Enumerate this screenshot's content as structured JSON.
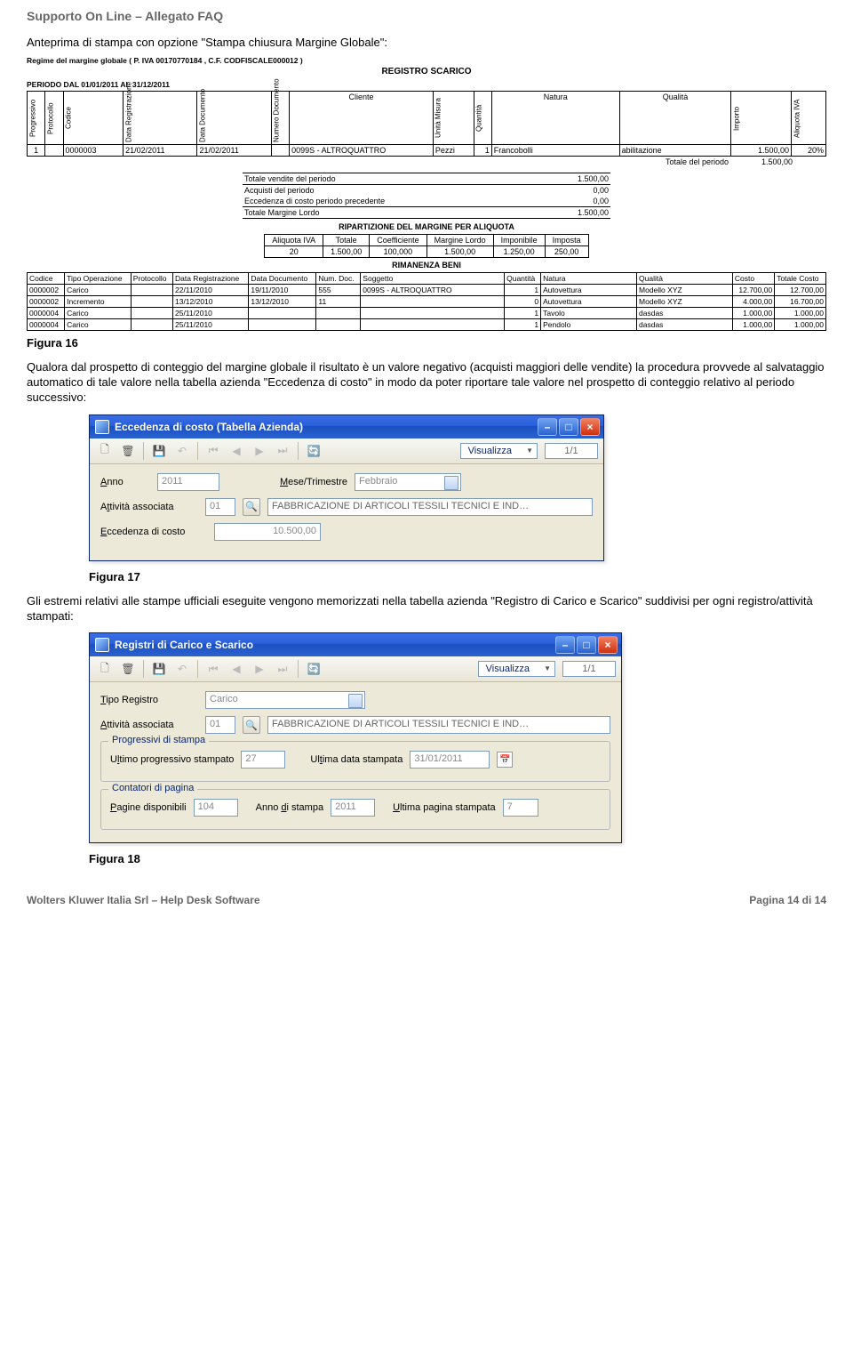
{
  "page": {
    "header": "Supporto On Line – Allegato FAQ",
    "intro": "Anteprima di stampa con opzione \"Stampa chiusura Margine Globale\":",
    "fig16": "Figura 16",
    "para1": "Qualora dal prospetto di conteggio del margine globale il risultato è un valore negativo (acquisti maggiori delle vendite) la procedura provvede al salvataggio automatico di tale valore nella tabella azienda \"Eccedenza di costo\" in modo da poter riportare tale valore nel prospetto di conteggio relativo al periodo successivo:",
    "fig17": "Figura 17",
    "para2": "Gli estremi relativi alle stampe ufficiali eseguite vengono memorizzati nella tabella azienda \"Registro di Carico e Scarico\" suddivisi per ogni registro/attività stampati:",
    "fig18": "Figura 18",
    "footer_left": "Wolters Kluwer Italia Srl – Help Desk Software",
    "footer_right": "Pagina 14 di 14"
  },
  "report": {
    "regime": "Regime del margine globale ( P. IVA 00170770184 , C.F. CODFISCALE000012 )",
    "title": "REGISTRO SCARICO",
    "period": "PERIODO DAL 01/01/2011 AL 31/12/2011",
    "cols": [
      "Progressivo",
      "Protocollo",
      "Codice",
      "Data Registrazione",
      "Data Documento",
      "Numero Documento",
      "Cliente",
      "Unità Misura",
      "Quantità",
      "Natura",
      "Qualità",
      "Importo",
      "Aliquota IVA"
    ],
    "row": [
      "1",
      "",
      "0000003",
      "21/02/2011",
      "21/02/2011",
      "",
      "0099S - ALTROQUATTRO",
      "Pezzi",
      "1",
      "Francobolli",
      "abilitazione",
      "1.500,00",
      "20%"
    ],
    "totperiodo_lbl": "Totale del periodo",
    "totperiodo_val": "1.500,00",
    "summaries": [
      {
        "l": "Totale vendite del periodo",
        "v": "1.500,00"
      },
      {
        "l": "Acquisti del periodo",
        "v": "0,00"
      },
      {
        "l": "Eccedenza di costo periodo precedente",
        "v": "0,00"
      },
      {
        "l": "Totale Margine Lordo",
        "v": "1.500,00"
      }
    ],
    "sub1": "RIPARTIZIONE DEL MARGINE PER ALIQUOTA",
    "aliquota_cols": [
      "Aliquota IVA",
      "Totale",
      "Coefficiente",
      "Margine Lordo",
      "Imponibile",
      "Imposta"
    ],
    "aliquota_row": [
      "20",
      "1.500,00",
      "100,000",
      "1.500,00",
      "1.250,00",
      "250,00"
    ],
    "sub2": "RIMANENZA BENI",
    "rim_cols": [
      "Codice",
      "Tipo Operazione",
      "Protocollo",
      "Data Registrazione",
      "Data Documento",
      "Num. Doc.",
      "Soggetto",
      "Quantità",
      "Natura",
      "Qualità",
      "Costo",
      "Totale Costo"
    ],
    "rim_rows": [
      [
        "0000002",
        "Carico",
        "",
        "22/11/2010",
        "19/11/2010",
        "555",
        "0099S - ALTROQUATTRO",
        "1",
        "Autovettura",
        "Modello XYZ",
        "12.700,00",
        "12.700,00"
      ],
      [
        "0000002",
        "Incremento",
        "",
        "13/12/2010",
        "13/12/2010",
        "11",
        "",
        "0",
        "Autovettura",
        "Modello XYZ",
        "4.000,00",
        "16.700,00"
      ],
      [
        "0000004",
        "Carico",
        "",
        "25/11/2010",
        "",
        "",
        "",
        "1",
        "Tavolo",
        "dasdas",
        "1.000,00",
        "1.000,00"
      ],
      [
        "0000004",
        "Carico",
        "",
        "25/11/2010",
        "",
        "",
        "",
        "1",
        "Pendolo",
        "dasdas",
        "1.000,00",
        "1.000,00"
      ]
    ]
  },
  "win1": {
    "title": "Eccedenza di costo (Tabella Azienda)",
    "vis": "Visualizza",
    "pager": "1/1",
    "label_anno": "Anno",
    "anno": "2011",
    "label_mese": "Mese/Trimestre",
    "mese": "Febbraio",
    "label_att": "Attività associata",
    "att_code": "01",
    "att_desc": "FABBRICAZIONE DI ARTICOLI TESSILI TECNICI E IND…",
    "label_ecc": "Eccedenza di costo",
    "ecc": "10.500,00"
  },
  "win2": {
    "title": "Registri di Carico e Scarico",
    "vis": "Visualizza",
    "pager": "1/1",
    "label_tipo": "Tipo Registro",
    "tipo": "Carico",
    "label_att": "Attività associata",
    "att_code": "01",
    "att_desc": "FABBRICAZIONE DI ARTICOLI TESSILI TECNICI E IND…",
    "group1": "Progressivi di stampa",
    "label_ult_prog": "Ultimo progressivo stampato",
    "ult_prog": "27",
    "label_ult_data": "Ultima data stampata",
    "ult_data": "31/01/2011",
    "group2": "Contatori di pagina",
    "label_pag_disp": "Pagine disponibili",
    "pag_disp": "104",
    "label_anno_st": "Anno di stampa",
    "anno_st": "2011",
    "label_ult_pag": "Ultima pagina stampata",
    "ult_pag": "7"
  }
}
